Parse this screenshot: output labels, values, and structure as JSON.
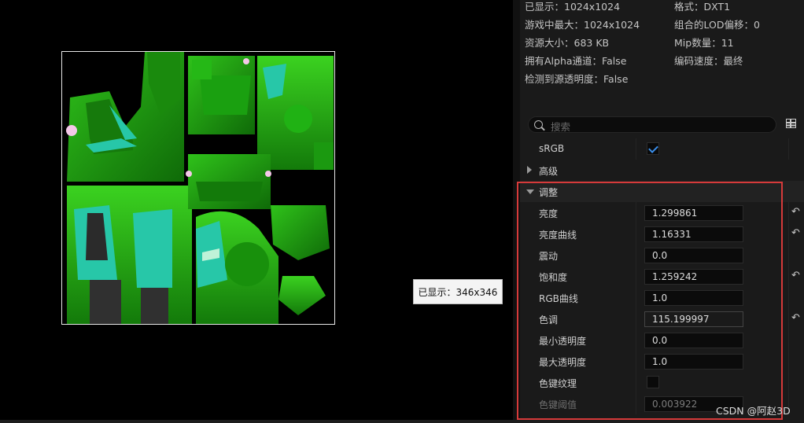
{
  "info": {
    "displayed": "已显示：1024x1024",
    "max_in_game": "游戏中最大：1024x1024",
    "resource_size": "资源大小：683 KB",
    "has_alpha": "拥有Alpha通道：False",
    "detected_alpha": "检测到源透明度：False",
    "format": "格式：DXT1",
    "lod_bias": "组合的LOD偏移：0",
    "mip_count": "Mip数量：11",
    "encode_speed": "编码速度：最终"
  },
  "viewport": {
    "tooltip": "已显示：346x346"
  },
  "search": {
    "placeholder": "搜索"
  },
  "srgb": {
    "label": "sRGB",
    "checked": true
  },
  "advanced": {
    "label": "高级"
  },
  "adjust": {
    "label": "调整",
    "rows": [
      {
        "label": "亮度",
        "value": "1.299861",
        "reset": true
      },
      {
        "label": "亮度曲线",
        "value": "1.16331",
        "reset": true
      },
      {
        "label": "震动",
        "value": "0.0",
        "reset": false
      },
      {
        "label": "饱和度",
        "value": "1.259242",
        "reset": true
      },
      {
        "label": "RGB曲线",
        "value": "1.0",
        "reset": false
      },
      {
        "label": "色调",
        "value": "115.199997",
        "reset": true
      },
      {
        "label": "最小透明度",
        "value": "0.0",
        "reset": false
      },
      {
        "label": "最大透明度",
        "value": "1.0",
        "reset": false
      },
      {
        "label": "色键纹理",
        "checkbox": true,
        "checked": false
      },
      {
        "label": "色键阈值",
        "value": "0.003922",
        "reset": false,
        "disabled": true
      }
    ]
  },
  "watermark": "CSDN @阿赵3D",
  "colors": {
    "highlight": "#d63a3a",
    "accent": "#3a8eea",
    "texture_green": "#1e9a12"
  }
}
